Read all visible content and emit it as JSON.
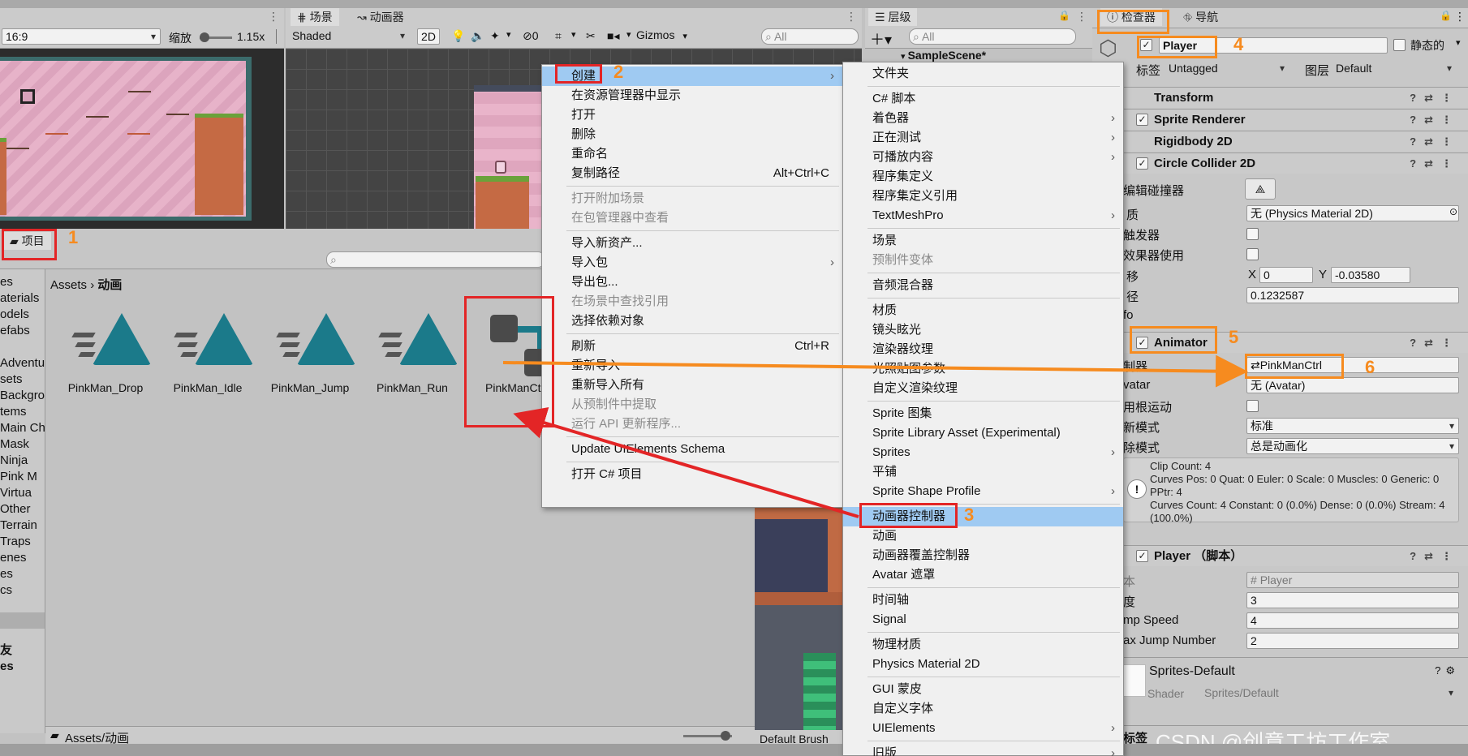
{
  "game_panel": {
    "aspect": "16:9",
    "scale_label": "缩放",
    "scale_value": "1.15x"
  },
  "scene_panel": {
    "tab_scene": "场景",
    "tab_animator": "动画器",
    "shading": "Shaded",
    "mode_2d": "2D",
    "hidden_count": "0",
    "gizmos": "Gizmos",
    "search_placeholder": "All"
  },
  "hierarchy_panel": {
    "tab": "层级",
    "search_placeholder": "All",
    "scene_name": "SampleScene*"
  },
  "inspector_panel": {
    "tab_inspector": "检查器",
    "tab_navigation": "导航",
    "object_name": "Player",
    "static_label": "静态的",
    "tag_label": "标签",
    "tag_value": "Untagged",
    "layer_label": "图层",
    "layer_value": "Default",
    "components": [
      {
        "name": "Transform"
      },
      {
        "name": "Sprite Renderer"
      },
      {
        "name": "Rigidbody 2D"
      },
      {
        "name": "Circle Collider 2D"
      }
    ],
    "collider_fields": {
      "edit_label": "编辑碰撞器",
      "material_label": "质",
      "material_value": "无 (Physics Material 2D)",
      "trigger_label": "触发器",
      "effector_label": "效果器使用",
      "offset_label": "移",
      "offset_x_label": "X",
      "offset_x": "0",
      "offset_y_label": "Y",
      "offset_y": "-0.03580",
      "radius_label": "径",
      "radius": "0.1232587",
      "info_label": "fo"
    },
    "animator": {
      "name": "Animator",
      "controller_label": "制器",
      "controller_value": "PinkManCtrl",
      "avatar_label": "vatar",
      "avatar_value": "无 (Avatar)",
      "root_motion_label": "用根运动",
      "update_mode_label": "新模式",
      "update_mode_value": "标准",
      "culling_label": "除模式",
      "culling_value": "总是动画化",
      "info_text": "Clip Count: 4\nCurves Pos: 0 Quat: 0 Euler: 0 Scale: 0 Muscles: 0 Generic: 0 PPtr: 4\nCurves Count: 4 Constant: 0 (0.0%) Dense: 0 (0.0%) Stream: 4 (100.0%)"
    },
    "script": {
      "name": "Player （脚本）",
      "script_label": "本",
      "script_value": "Player",
      "speed_label": "度",
      "speed_value": "3",
      "jump_speed_label": "mp Speed",
      "jump_speed_value": "4",
      "max_jump_label": "ax Jump Number",
      "max_jump_value": "2"
    },
    "material": {
      "name": "Sprites-Default",
      "shader_label": "Shader",
      "shader_value": "Sprites/Default"
    },
    "footer_label": "标签"
  },
  "project_panel": {
    "tab": "项目",
    "breadcrumb_root": "Assets",
    "breadcrumb_current": "动画",
    "tree": [
      "es",
      "aterials",
      "odels",
      "efabs",
      "",
      "Adventu",
      "sets",
      "Backgro",
      "tems",
      "Main Ch",
      "Mask",
      "Ninja",
      "Pink M",
      "Virtua",
      "Other",
      "Terrain",
      "Traps",
      "enes",
      "es",
      "cs"
    ],
    "tree_bottom": [
      "友",
      "es"
    ],
    "assets": [
      "PinkMan_Drop",
      "PinkMan_Idle",
      "PinkMan_Jump",
      "PinkMan_Run",
      "PinkManCtrl"
    ],
    "path_footer": "Assets/动画",
    "brush": "Default Brush"
  },
  "context_menu": {
    "items": [
      {
        "label": "创建",
        "arrow": "›"
      },
      {
        "label": "在资源管理器中显示"
      },
      {
        "label": "打开"
      },
      {
        "label": "删除"
      },
      {
        "label": "重命名"
      },
      {
        "label": "复制路径",
        "shortcut": "Alt+Ctrl+C"
      },
      {
        "label": "打开附加场景"
      },
      {
        "label": "在包管理器中查看"
      },
      {
        "label": "导入新资产..."
      },
      {
        "label": "导入包",
        "arrow": "›"
      },
      {
        "label": "导出包..."
      },
      {
        "label": "在场景中查找引用"
      },
      {
        "label": "选择依赖对象"
      },
      {
        "label": "刷新",
        "shortcut": "Ctrl+R"
      },
      {
        "label": "重新导入"
      },
      {
        "label": "重新导入所有"
      },
      {
        "label": "从预制件中提取"
      },
      {
        "label": "运行 API 更新程序..."
      },
      {
        "label": "Update UIElements Schema"
      },
      {
        "label": "打开 C# 项目"
      }
    ]
  },
  "create_submenu": {
    "items": [
      {
        "label": "文件夹"
      },
      {
        "label": "C# 脚本"
      },
      {
        "label": "着色器",
        "arrow": "›"
      },
      {
        "label": "正在测试",
        "arrow": "›"
      },
      {
        "label": "可播放内容",
        "arrow": "›"
      },
      {
        "label": "程序集定义"
      },
      {
        "label": "程序集定义引用"
      },
      {
        "label": "TextMeshPro",
        "arrow": "›"
      },
      {
        "label": "场景"
      },
      {
        "label": "预制件变体"
      },
      {
        "label": "音频混合器"
      },
      {
        "label": "材质"
      },
      {
        "label": "镜头眩光"
      },
      {
        "label": "渲染器纹理"
      },
      {
        "label": "光照贴图参数"
      },
      {
        "label": "自定义渲染纹理"
      },
      {
        "label": "Sprite 图集"
      },
      {
        "label": "Sprite Library Asset (Experimental)"
      },
      {
        "label": "Sprites",
        "arrow": "›"
      },
      {
        "label": "平铺"
      },
      {
        "label": "Sprite Shape Profile",
        "arrow": "›"
      },
      {
        "label": "动画器控制器"
      },
      {
        "label": "动画"
      },
      {
        "label": "动画器覆盖控制器"
      },
      {
        "label": "Avatar 遮罩"
      },
      {
        "label": "时间轴"
      },
      {
        "label": "Signal"
      },
      {
        "label": "物理材质"
      },
      {
        "label": "Physics Material 2D"
      },
      {
        "label": "GUI 蒙皮"
      },
      {
        "label": "自定义字体"
      },
      {
        "label": "UIElements",
        "arrow": "›"
      },
      {
        "label": "旧版",
        "arrow": "›"
      }
    ]
  },
  "annotations": {
    "n1": "1",
    "n2": "2",
    "n3": "3",
    "n4": "4",
    "n5": "5",
    "n6": "6"
  },
  "watermark": "CSDN @创意工坊工作室",
  "colors": {
    "accent_red": "#e32526",
    "accent_orange": "#f68b1f",
    "menu_highlight": "#9fcaf2",
    "teal_icon": "#1b7a8a"
  }
}
